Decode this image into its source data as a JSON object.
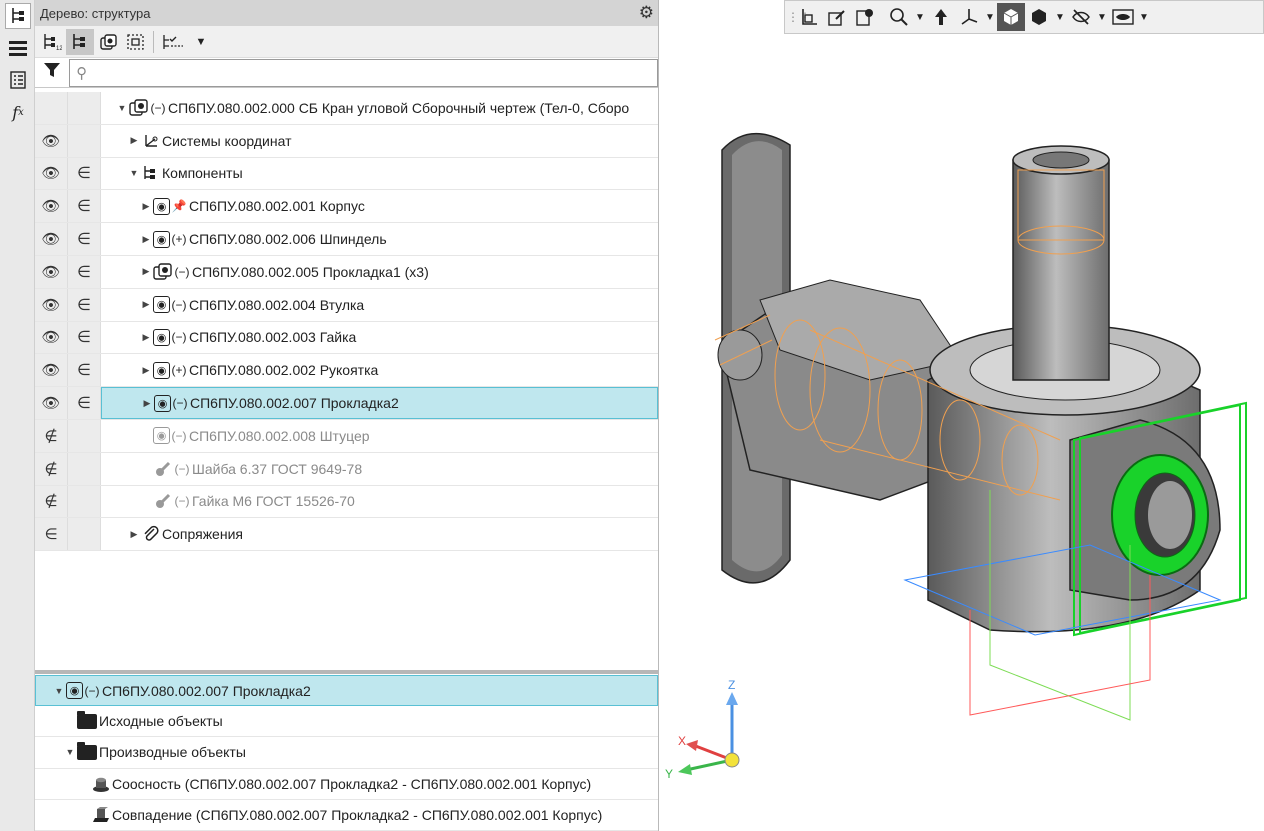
{
  "panel": {
    "title": "Дерево: структура",
    "search_placeholder": ""
  },
  "tree": {
    "root": "СП6ПУ.080.002.000 СБ Кран угловой Сборочный чертеж (Тел-0, Сборо",
    "coord_systems": "Системы координат",
    "components": "Компоненты",
    "items": [
      {
        "label": "СП6ПУ.080.002.001 Корпус",
        "sign": "pin",
        "dim": false,
        "selected": false
      },
      {
        "label": "СП6ПУ.080.002.006 Шпиндель",
        "sign": "+",
        "dim": false,
        "selected": false
      },
      {
        "label": "СП6ПУ.080.002.005 Прокладка1 (x3)",
        "sign": "−",
        "dim": false,
        "selected": false
      },
      {
        "label": "СП6ПУ.080.002.004 Втулка",
        "sign": "−",
        "dim": false,
        "selected": false
      },
      {
        "label": "СП6ПУ.080.002.003 Гайка",
        "sign": "−",
        "dim": false,
        "selected": false
      },
      {
        "label": "СП6ПУ.080.002.002 Рукоятка",
        "sign": "+",
        "dim": false,
        "selected": false
      },
      {
        "label": "СП6ПУ.080.002.007 Прокладка2",
        "sign": "−",
        "dim": false,
        "selected": true
      },
      {
        "label": "СП6ПУ.080.002.008 Штуцер",
        "sign": "−",
        "dim": true,
        "selected": false
      },
      {
        "label": "Шайба 6.37 ГОСТ 9649-78",
        "sign": "−",
        "dim": true,
        "selected": false
      },
      {
        "label": "Гайка М6 ГОСТ 15526-70",
        "sign": "−",
        "dim": true,
        "selected": false
      }
    ],
    "mates": "Сопряжения"
  },
  "bottom": {
    "head": "СП6ПУ.080.002.007 Прокладка2",
    "source": "Исходные объекты",
    "derived": "Производные объекты",
    "constraints": [
      "Соосность (СП6ПУ.080.002.007 Прокладка2  -  СП6ПУ.080.002.001 Корпус)",
      "Совпадение (СП6ПУ.080.002.007 Прокладка2  -  СП6ПУ.080.002.001 Корпус)"
    ]
  },
  "axes": {
    "x": "X",
    "y": "Y",
    "z": "Z"
  },
  "colors": {
    "selection_bg": "#bfe7ee",
    "selection_border": "#59c0d4",
    "highlight_green": "#19d22a",
    "sketch_orange": "#f0a050"
  }
}
